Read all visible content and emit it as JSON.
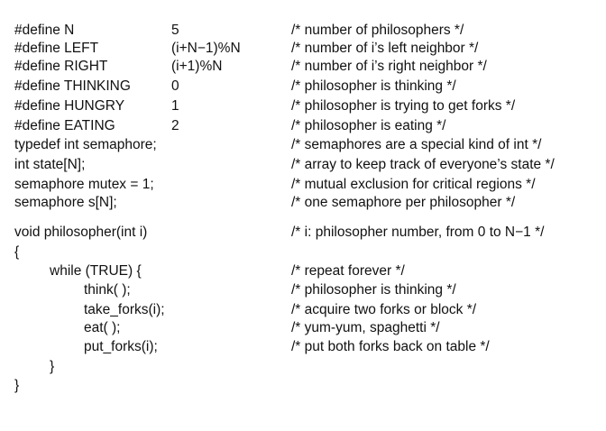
{
  "defines": [
    {
      "name": "#define N",
      "value": "5",
      "comment": "/* number of philosophers */"
    },
    {
      "name": "#define LEFT",
      "value": "(i+N−1)%N",
      "comment": "/* number of i’s left neighbor */"
    },
    {
      "name": "#define RIGHT",
      "value": "(i+1)%N",
      "comment": "/* number of i’s right neighbor */"
    },
    {
      "name": "#define THINKING",
      "value": "0",
      "comment": "/* philosopher is thinking */"
    },
    {
      "name": "#define HUNGRY",
      "value": "1",
      "comment": "/* philosopher is trying to get forks */"
    },
    {
      "name": "#define EATING",
      "value": "2",
      "comment": "/* philosopher is eating */"
    }
  ],
  "declarations": [
    {
      "code": "typedef int semaphore;",
      "comment": "/* semaphores are a special kind of int */"
    },
    {
      "code": "int state[N];",
      "comment": "/* array to keep track of everyone’s state */"
    },
    {
      "code": "semaphore mutex = 1;",
      "comment": "/* mutual exclusion for critical regions */"
    },
    {
      "code": "semaphore s[N];",
      "comment": "/* one semaphore per philosopher */"
    }
  ],
  "function": {
    "signature": "void philosopher(int i)",
    "signature_comment": "/* i: philosopher number, from 0 to N−1 */",
    "open_brace": "{",
    "loop": "while (TRUE) {",
    "loop_comment": "/* repeat forever */",
    "body": [
      {
        "code": "think( );",
        "comment": "/* philosopher is thinking */"
      },
      {
        "code": "take_forks(i);",
        "comment": "/* acquire two forks or block */"
      },
      {
        "code": "eat( );",
        "comment": "/* yum-yum, spaghetti */"
      },
      {
        "code": "put_forks(i);",
        "comment": "/* put both forks back on table */"
      }
    ],
    "loop_close": "}",
    "close_brace": "}"
  }
}
